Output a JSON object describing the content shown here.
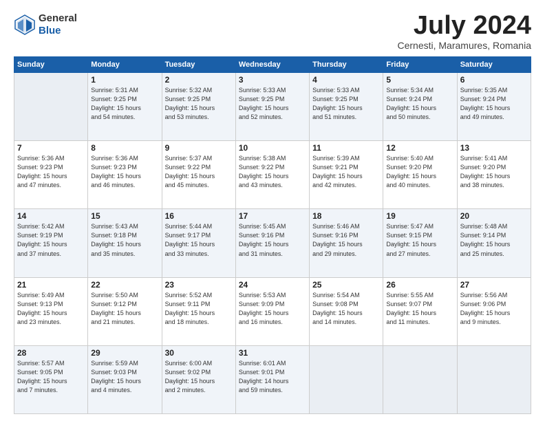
{
  "header": {
    "logo_general": "General",
    "logo_blue": "Blue",
    "month": "July 2024",
    "location": "Cernesti, Maramures, Romania"
  },
  "days_of_week": [
    "Sunday",
    "Monday",
    "Tuesday",
    "Wednesday",
    "Thursday",
    "Friday",
    "Saturday"
  ],
  "weeks": [
    [
      {
        "day": "",
        "info": ""
      },
      {
        "day": "1",
        "info": "Sunrise: 5:31 AM\nSunset: 9:25 PM\nDaylight: 15 hours\nand 54 minutes."
      },
      {
        "day": "2",
        "info": "Sunrise: 5:32 AM\nSunset: 9:25 PM\nDaylight: 15 hours\nand 53 minutes."
      },
      {
        "day": "3",
        "info": "Sunrise: 5:33 AM\nSunset: 9:25 PM\nDaylight: 15 hours\nand 52 minutes."
      },
      {
        "day": "4",
        "info": "Sunrise: 5:33 AM\nSunset: 9:25 PM\nDaylight: 15 hours\nand 51 minutes."
      },
      {
        "day": "5",
        "info": "Sunrise: 5:34 AM\nSunset: 9:24 PM\nDaylight: 15 hours\nand 50 minutes."
      },
      {
        "day": "6",
        "info": "Sunrise: 5:35 AM\nSunset: 9:24 PM\nDaylight: 15 hours\nand 49 minutes."
      }
    ],
    [
      {
        "day": "7",
        "info": "Sunrise: 5:36 AM\nSunset: 9:23 PM\nDaylight: 15 hours\nand 47 minutes."
      },
      {
        "day": "8",
        "info": "Sunrise: 5:36 AM\nSunset: 9:23 PM\nDaylight: 15 hours\nand 46 minutes."
      },
      {
        "day": "9",
        "info": "Sunrise: 5:37 AM\nSunset: 9:22 PM\nDaylight: 15 hours\nand 45 minutes."
      },
      {
        "day": "10",
        "info": "Sunrise: 5:38 AM\nSunset: 9:22 PM\nDaylight: 15 hours\nand 43 minutes."
      },
      {
        "day": "11",
        "info": "Sunrise: 5:39 AM\nSunset: 9:21 PM\nDaylight: 15 hours\nand 42 minutes."
      },
      {
        "day": "12",
        "info": "Sunrise: 5:40 AM\nSunset: 9:20 PM\nDaylight: 15 hours\nand 40 minutes."
      },
      {
        "day": "13",
        "info": "Sunrise: 5:41 AM\nSunset: 9:20 PM\nDaylight: 15 hours\nand 38 minutes."
      }
    ],
    [
      {
        "day": "14",
        "info": "Sunrise: 5:42 AM\nSunset: 9:19 PM\nDaylight: 15 hours\nand 37 minutes."
      },
      {
        "day": "15",
        "info": "Sunrise: 5:43 AM\nSunset: 9:18 PM\nDaylight: 15 hours\nand 35 minutes."
      },
      {
        "day": "16",
        "info": "Sunrise: 5:44 AM\nSunset: 9:17 PM\nDaylight: 15 hours\nand 33 minutes."
      },
      {
        "day": "17",
        "info": "Sunrise: 5:45 AM\nSunset: 9:16 PM\nDaylight: 15 hours\nand 31 minutes."
      },
      {
        "day": "18",
        "info": "Sunrise: 5:46 AM\nSunset: 9:16 PM\nDaylight: 15 hours\nand 29 minutes."
      },
      {
        "day": "19",
        "info": "Sunrise: 5:47 AM\nSunset: 9:15 PM\nDaylight: 15 hours\nand 27 minutes."
      },
      {
        "day": "20",
        "info": "Sunrise: 5:48 AM\nSunset: 9:14 PM\nDaylight: 15 hours\nand 25 minutes."
      }
    ],
    [
      {
        "day": "21",
        "info": "Sunrise: 5:49 AM\nSunset: 9:13 PM\nDaylight: 15 hours\nand 23 minutes."
      },
      {
        "day": "22",
        "info": "Sunrise: 5:50 AM\nSunset: 9:12 PM\nDaylight: 15 hours\nand 21 minutes."
      },
      {
        "day": "23",
        "info": "Sunrise: 5:52 AM\nSunset: 9:11 PM\nDaylight: 15 hours\nand 18 minutes."
      },
      {
        "day": "24",
        "info": "Sunrise: 5:53 AM\nSunset: 9:09 PM\nDaylight: 15 hours\nand 16 minutes."
      },
      {
        "day": "25",
        "info": "Sunrise: 5:54 AM\nSunset: 9:08 PM\nDaylight: 15 hours\nand 14 minutes."
      },
      {
        "day": "26",
        "info": "Sunrise: 5:55 AM\nSunset: 9:07 PM\nDaylight: 15 hours\nand 11 minutes."
      },
      {
        "day": "27",
        "info": "Sunrise: 5:56 AM\nSunset: 9:06 PM\nDaylight: 15 hours\nand 9 minutes."
      }
    ],
    [
      {
        "day": "28",
        "info": "Sunrise: 5:57 AM\nSunset: 9:05 PM\nDaylight: 15 hours\nand 7 minutes."
      },
      {
        "day": "29",
        "info": "Sunrise: 5:59 AM\nSunset: 9:03 PM\nDaylight: 15 hours\nand 4 minutes."
      },
      {
        "day": "30",
        "info": "Sunrise: 6:00 AM\nSunset: 9:02 PM\nDaylight: 15 hours\nand 2 minutes."
      },
      {
        "day": "31",
        "info": "Sunrise: 6:01 AM\nSunset: 9:01 PM\nDaylight: 14 hours\nand 59 minutes."
      },
      {
        "day": "",
        "info": ""
      },
      {
        "day": "",
        "info": ""
      },
      {
        "day": "",
        "info": ""
      }
    ]
  ]
}
